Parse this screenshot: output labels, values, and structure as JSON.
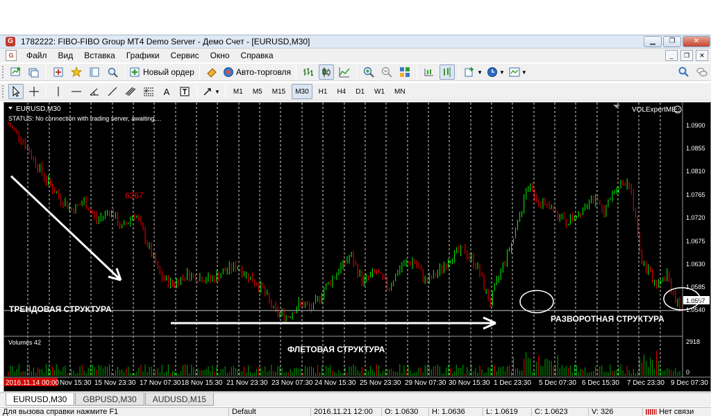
{
  "window": {
    "title": "1782222: FIBO-FIBO Group MT4 Demo Server - Демо Счет - [EURUSD,M30]",
    "app_icon": "metatrader-icon",
    "buttons": [
      "minimize",
      "maximize",
      "close"
    ]
  },
  "menu": {
    "items": [
      "Файл",
      "Вид",
      "Вставка",
      "Графики",
      "Сервис",
      "Окно",
      "Справка"
    ]
  },
  "toolbar1": {
    "new_order_label": "Новый ордер",
    "autotrading_label": "Авто-торговля"
  },
  "toolbar2": {
    "timeframes": [
      "M1",
      "M5",
      "M15",
      "M30",
      "H1",
      "H4",
      "D1",
      "W1",
      "MN"
    ],
    "active_timeframe": "M30",
    "text_tool_label": "A"
  },
  "chart": {
    "symbol_label": "EURUSD,M30",
    "status_text": "STATUS:   No connection with trading server, awaiting....",
    "expert_label": "VOLExpertME",
    "volumes_label": "Volumes 42",
    "current_price": "1.0557",
    "price_ticks": [
      "1.0900",
      "1.0855",
      "1.0810",
      "1.0765",
      "1.0720",
      "1.0675",
      "1.0630",
      "1.0585",
      "1.0540"
    ],
    "volume_ticks": [
      "2918",
      "0"
    ],
    "time_labels": [
      "2016.11.14 00:00",
      "Nov 15:30",
      "15 Nov 23:30",
      "17 Nov 07:30",
      "18 Nov 15:30",
      "21 Nov 23:30",
      "23 Nov 07:30",
      "24 Nov 15:30",
      "25 Nov 23:30",
      "29 Nov 07:30",
      "30 Nov 15:30",
      "1 Dec 23:30",
      "5 Dec 07:30",
      "6 Dec 15:30",
      "7 Dec 23:30",
      "9 Dec 07:30"
    ],
    "annotation_number": "6267",
    "label_trend": "ТРЕНДОВАЯ СТРУКТУРА",
    "label_flat": "ФЛЕТОВАЯ СТРУКТУРА",
    "label_reversal": "РАЗВОРОТНАЯ СТРУКТУРА",
    "bull_color": "#00ff00",
    "bear_color": "#ff0000",
    "volume_color": "#00aa00"
  },
  "tabs": {
    "items": [
      "EURUSD,M30",
      "GBPUSD,M30",
      "AUDUSD,M15"
    ],
    "active": "EURUSD,M30"
  },
  "status": {
    "help": "Для вызова справки нажмите F1",
    "profile": "Default",
    "datetime": "2016.11.21 12:00",
    "open": "O: 1.0630",
    "high": "H: 1.0636",
    "low": "L: 1.0619",
    "close": "C: 1.0623",
    "volume": "V: 326",
    "connection": "Нет связи"
  },
  "chart_data": {
    "type": "candlestick",
    "symbol": "EURUSD",
    "timeframe": "M30",
    "y_range": [
      1.0518,
      1.0922
    ],
    "x": [
      "2016.11.14 00:00",
      "Nov 15:30",
      "15 Nov 23:30",
      "17 Nov 07:30",
      "18 Nov 15:30",
      "21 Nov 23:30",
      "23 Nov 07:30",
      "24 Nov 15:30",
      "25 Nov 23:30",
      "29 Nov 07:30",
      "30 Nov 15:30",
      "1 Dec 23:30",
      "5 Dec 07:30",
      "6 Dec 15:30",
      "7 Dec 23:30",
      "9 Dec 07:30"
    ],
    "close_path": [
      1.0905,
      1.088,
      1.084,
      1.08,
      1.077,
      1.0745,
      1.076,
      1.0725,
      1.0745,
      1.071,
      1.074,
      1.068,
      1.062,
      1.0605,
      1.0625,
      1.062,
      1.0615,
      1.063,
      1.064,
      1.062,
      1.06,
      1.0555,
      1.0545,
      1.057,
      1.056,
      1.06,
      1.063,
      1.066,
      1.061,
      1.063,
      1.06,
      1.064,
      1.065,
      1.061,
      1.063,
      1.066,
      1.067,
      1.064,
      1.057,
      1.064,
      1.07,
      1.079,
      1.076,
      1.074,
      1.072,
      1.074,
      1.077,
      1.074,
      1.079,
      1.08,
      1.065,
      1.061,
      1.062,
      1.0557
    ],
    "horizontal_line": 1.0557
  }
}
